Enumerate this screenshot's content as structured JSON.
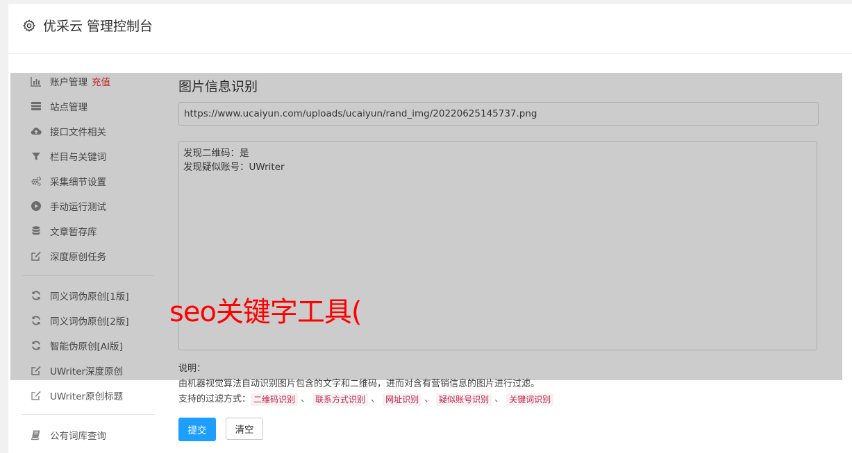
{
  "header": {
    "title": "优采云 管理控制台",
    "icon": "gear-icon"
  },
  "sidebar": {
    "items": [
      {
        "label": "账户管理",
        "badge": "充值",
        "icon": "bar-chart-icon"
      },
      {
        "label": "站点管理",
        "icon": "server-icon"
      },
      {
        "label": "接口文件相关",
        "icon": "cloud-upload-icon"
      },
      {
        "label": "栏目与关键词",
        "icon": "filter-icon"
      },
      {
        "label": "采集细节设置",
        "icon": "cogs-icon"
      },
      {
        "label": "手动运行测试",
        "icon": "play-circle-icon"
      },
      {
        "label": "文章暂存库",
        "icon": "database-icon"
      },
      {
        "label": "深度原创任务",
        "icon": "edit-icon"
      },
      {
        "label": "同义词伪原创[1版]",
        "icon": "refresh-icon"
      },
      {
        "label": "同义词伪原创[2版]",
        "icon": "refresh-icon"
      },
      {
        "label": "智能伪原创[AI版]",
        "icon": "refresh-icon"
      },
      {
        "label": "UWriter深度原创",
        "icon": "edit-icon"
      },
      {
        "label": "UWriter原创标题",
        "icon": "edit-icon"
      },
      {
        "label": "公有词库查询",
        "icon": "book-icon"
      }
    ]
  },
  "main": {
    "title": "图片信息识别",
    "url_value": "https://www.ucaiyun.com/uploads/ucaiyun/rand_img/20220625145737.png",
    "result_lines": [
      "发现二维码：是",
      "发现疑似账号：UWriter"
    ],
    "notes_label": "说明：",
    "description": "由机器视觉算法自动识别图片包含的文字和二维码，进而对含有营销信息的图片进行过滤。",
    "filter_label": "支持的过滤方式：",
    "filters": [
      "二维码识别",
      "联系方式识别",
      "网址识别",
      "疑似账号识别",
      "关键词识别"
    ],
    "filter_separator": "、",
    "submit_label": "提交",
    "clear_label": "清空"
  },
  "watermark": "seo关键字工具(",
  "colors": {
    "primary": "#1e9fff",
    "badge": "#e33333",
    "tag_text": "#c7254e",
    "watermark": "#ff0000"
  }
}
